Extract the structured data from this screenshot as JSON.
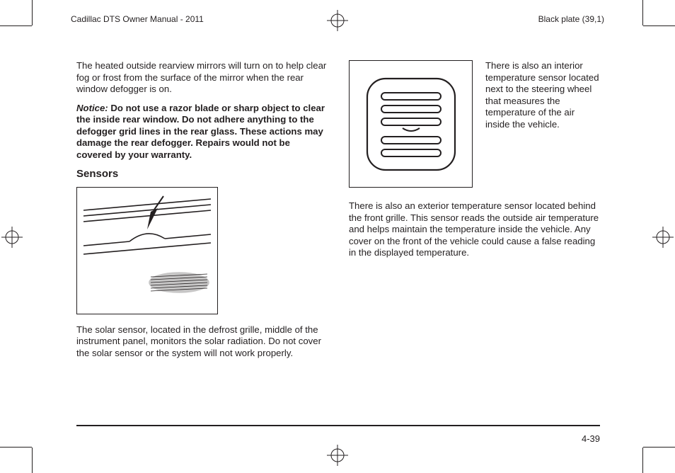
{
  "header": {
    "left": "Cadillac DTS Owner Manual - 2011",
    "right": "Black plate (39,1)"
  },
  "left_col": {
    "p1": "The heated outside rearview mirrors will turn on to help clear fog or frost from the surface of the mirror when the rear window defogger is on.",
    "notice_label": "Notice:",
    "notice_body": " Do not use a razor blade or sharp object to clear the inside rear window. Do not adhere anything to the defogger grid lines in the rear glass. These actions may damage the rear defogger. Repairs would not be covered by your warranty.",
    "h_sensors": "Sensors",
    "p2": "The solar sensor, located in the defrost grille, middle of the instrument panel, monitors the solar radiation. Do not cover the solar sensor or the system will not work properly."
  },
  "right_col": {
    "side": "There is also an interior temperature sensor located next to the steering wheel that measures the temperature of the air inside the vehicle.",
    "p3": "There is also an exterior temperature sensor located behind the front grille. This sensor reads the outside air temperature and helps maintain the temperature inside the vehicle. Any cover on the front of the vehicle could cause a false reading in the displayed temperature."
  },
  "footer": {
    "page_num": "4-39"
  }
}
